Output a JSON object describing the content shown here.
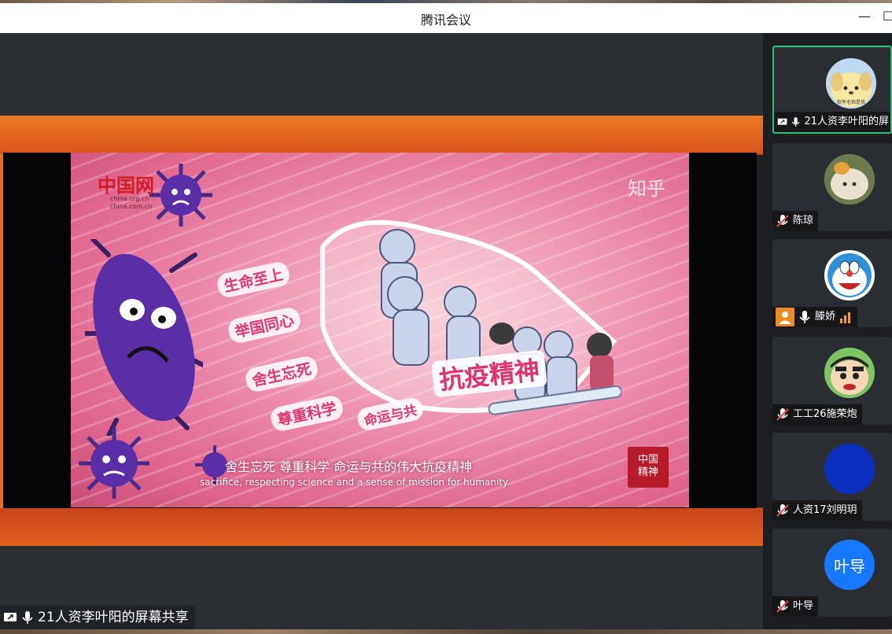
{
  "window": {
    "title": "腾讯会议",
    "minimize_glyph": "—",
    "maximize_glyph": "☐"
  },
  "slide": {
    "watermark": "知乎",
    "brand_logo": "中国网",
    "brand_sub_1": "china.org.cn",
    "brand_sub_2": "china.com.cn",
    "slogans": [
      "生命至上",
      "举国同心",
      "舍生忘死",
      "尊重科学",
      "命运与共"
    ],
    "big_slogan": "抗疫精神",
    "caption_cn": "舍生忘死 尊重科学 命运与共的伟大抗疫精神",
    "caption_en": "sacrifice, respecting science and a sense of mission for humanity.",
    "seal_text_1": "中国",
    "seal_text_2": "精神"
  },
  "share_label": {
    "text": "21人资李叶阳的屏幕共享"
  },
  "participants": [
    {
      "name": "21人资李叶阳的屏",
      "mic": "on",
      "sharing": true,
      "avatar": "cartoon-dog-icon",
      "avatar_color": "#f6e7a3",
      "avatar_caption": "软件毛但是我"
    },
    {
      "name": "陈琼",
      "mic": "muted",
      "sharing": false,
      "avatar": "plush-toy-icon",
      "avatar_color": "#c8a77a"
    },
    {
      "name": "滕娇",
      "mic": "on",
      "sharing": false,
      "avatar": "doraemon-icon",
      "avatar_color": "#4ea3e0",
      "badge": "user-icon",
      "signal": "signal-bars-icon"
    },
    {
      "name": "工工26施荣炮",
      "mic": "muted",
      "sharing": false,
      "avatar": "crayon-shin-chan-icon",
      "avatar_color": "#6dbf5a"
    },
    {
      "name": "人资17刘明玥",
      "mic": "muted",
      "sharing": false,
      "avatar": "blue-circle",
      "avatar_color": "#0a2fbf"
    },
    {
      "name": "叶导",
      "mic": "muted",
      "sharing": false,
      "avatar_text": "叶导",
      "avatar_color": "#1677ff"
    }
  ],
  "colors": {
    "accent_green": "#2ec27e",
    "muted_red": "#e5484d",
    "banner_orange": "#e47020"
  }
}
